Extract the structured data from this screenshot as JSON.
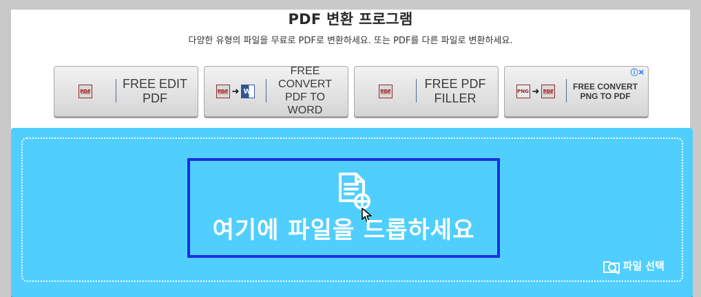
{
  "header": {
    "title": "PDF 변환 프로그램",
    "subtitle": "다양한 유형의 파일을 무료로 PDF로 변환하세요. 또는 PDF를 다른 파일로 변환하세요."
  },
  "ads": [
    {
      "icon": "pdf-icon",
      "text_line_1": "FREE EDIT",
      "text_line_2": "PDF"
    },
    {
      "icon": "pdf-to-word-icon",
      "text_line_1": "FREE CONVERT",
      "text_line_2": "PDF TO WORD"
    },
    {
      "icon": "pdf-icon",
      "text_line_1": "FREE PDF",
      "text_line_2": "FILLER"
    },
    {
      "icon": "png-to-pdf-icon",
      "text_line_1": "FREE CONVERT",
      "text_line_2": "PNG TO PDF",
      "info_label": "ⓘ✕"
    }
  ],
  "dropzone": {
    "drop_text": "여기에 파일을 드롭하세요",
    "select_file_label": "파일 선택",
    "icon": "file-plus-icon",
    "select_icon": "folder-search-icon",
    "colors": {
      "background": "#50cfff",
      "target_border": "#1e2ee0",
      "text": "#ffffff"
    }
  }
}
